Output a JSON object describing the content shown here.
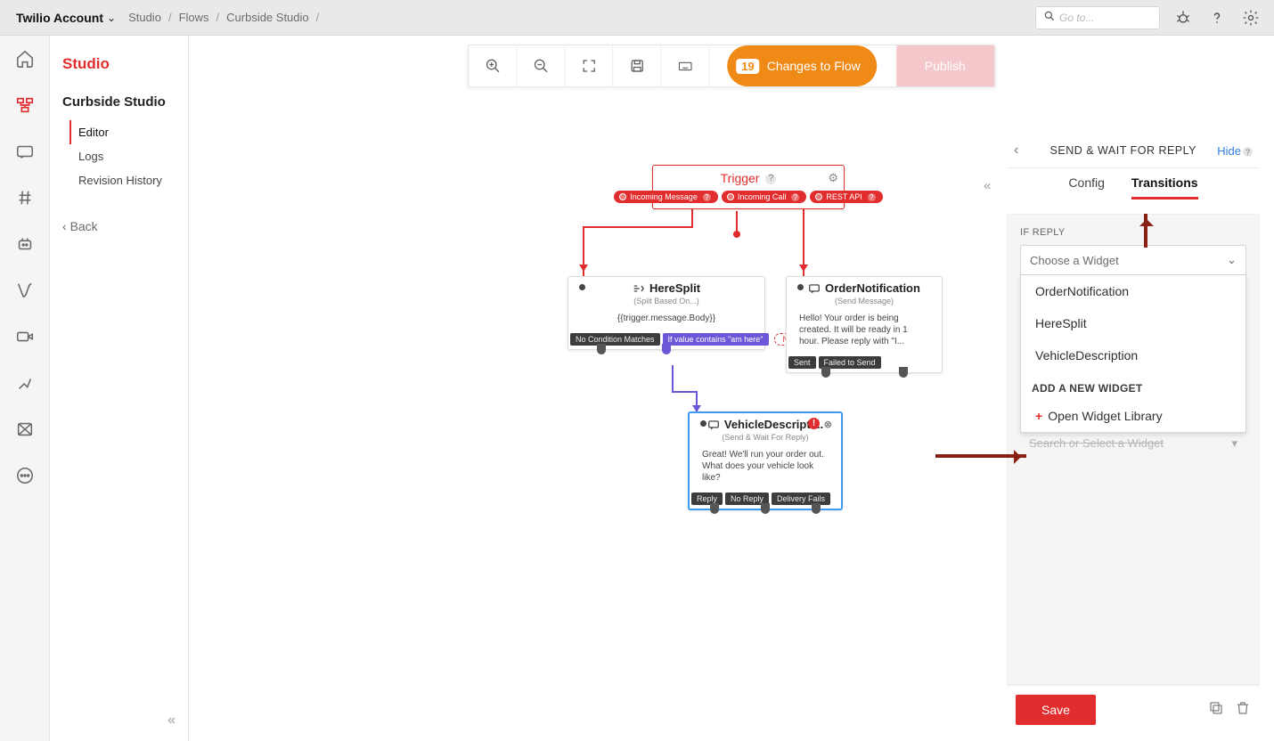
{
  "topbar": {
    "account": "Twilio Account",
    "crumbs": [
      "Studio",
      "Flows",
      "Curbside Studio"
    ],
    "search_placeholder": "Go to..."
  },
  "secnav": {
    "title": "Studio",
    "flowname": "Curbside Studio",
    "items": [
      "Editor",
      "Logs",
      "Revision History"
    ],
    "active_item": "Editor",
    "back": "Back"
  },
  "toolbar": {
    "changes_count": "19",
    "changes_label": "Changes to Flow",
    "publish_label": "Publish"
  },
  "nodes": {
    "trigger": {
      "title": "Trigger",
      "events": [
        "Incoming Message",
        "Incoming Call",
        "REST API"
      ]
    },
    "heresplit": {
      "title": "HereSplit",
      "subtitle": "(Split Based On...)",
      "body": "{{trigger.message.Body}}",
      "tags": [
        "No Condition Matches",
        "If value contains \"am here\""
      ],
      "new_label": "NEW"
    },
    "ordernotification": {
      "title": "OrderNotification",
      "subtitle": "(Send Message)",
      "body": "Hello! Your order is being created. It will be ready in 1 hour. Please reply with \"I...",
      "tags": [
        "Sent",
        "Failed to Send"
      ]
    },
    "vehicledescription": {
      "title": "VehicleDescripti...",
      "subtitle": "(Send & Wait For Reply)",
      "body": "Great! We'll run your order out. What does your vehicle look like?",
      "tags": [
        "Reply",
        "No Reply",
        "Delivery Fails"
      ]
    }
  },
  "inspector": {
    "title": "SEND & WAIT FOR REPLY",
    "hide": "Hide",
    "tabs": {
      "config": "Config",
      "transitions": "Transitions",
      "active": "Transitions"
    },
    "section_if_reply": "IF REPLY",
    "select_placeholder": "Choose a Widget",
    "options": [
      "OrderNotification",
      "HereSplit",
      "VehicleDescription"
    ],
    "group_header": "ADD A NEW WIDGET",
    "open_library": "Open Widget Library",
    "search_placeholder": "Search or Select a Widget",
    "save": "Save"
  }
}
